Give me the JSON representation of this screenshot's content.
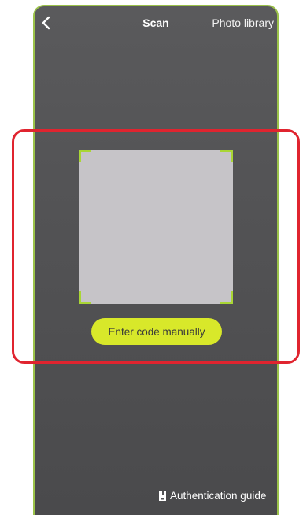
{
  "header": {
    "back_icon": "chevron-left-icon",
    "title": "Scan",
    "photo_library_label": "Photo library"
  },
  "scanner": {
    "manual_entry_label": "Enter code manually"
  },
  "footer": {
    "guide_icon": "book-icon",
    "guide_label": "Authentication guide"
  },
  "colors": {
    "accent": "#d8e82a",
    "frame_corner": "#a9d635",
    "device_border": "#9bc24a",
    "highlight": "#e0242f",
    "background": "#555557"
  }
}
